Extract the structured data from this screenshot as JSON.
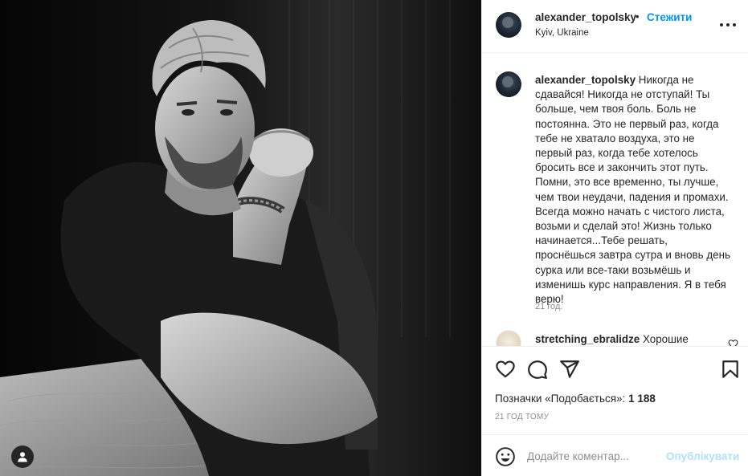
{
  "post": {
    "username": "alexander_topolsky",
    "dot": "•",
    "follow_label": "Стежити",
    "location": "Kyiv, Ukraine",
    "image_icon": "person-tag-icon"
  },
  "caption": {
    "username": "alexander_topolsky",
    "text": "Никогда не сдавайся! Никогда не отступай! Ты больше, чем твоя боль. Боль не постоянна. Это не первый раз, когда тебе не хватало воздуха, это не первый раз, когда тебе хотелось бросить все и закончить этот путь. Помни, это все временно, ты лучше, чем твои неудачи, падения и промахи. Всегда можно начать с чистого листа, возьми и сделай это! Жизнь только начинается...Тебе решать, проснёшься завтра сутра и вновь день сурка или все-таки возьмёшь и изменишь курс направления. Я в тебя верю!",
    "time": "21 год."
  },
  "comment": {
    "username": "stretching_ebralidze",
    "text": "Хорошие"
  },
  "actions": {
    "likes_prefix": "Позначки «Подобається»: ",
    "likes_count": "1 188",
    "posted_ago": "21 ГОД ТОМУ"
  },
  "composer": {
    "placeholder": "Додайте коментар...",
    "publish_label": "Опублікувати"
  },
  "colors": {
    "accent": "#0095f6",
    "publish_disabled": "#b2dffc",
    "muted": "#8e8e8e"
  }
}
